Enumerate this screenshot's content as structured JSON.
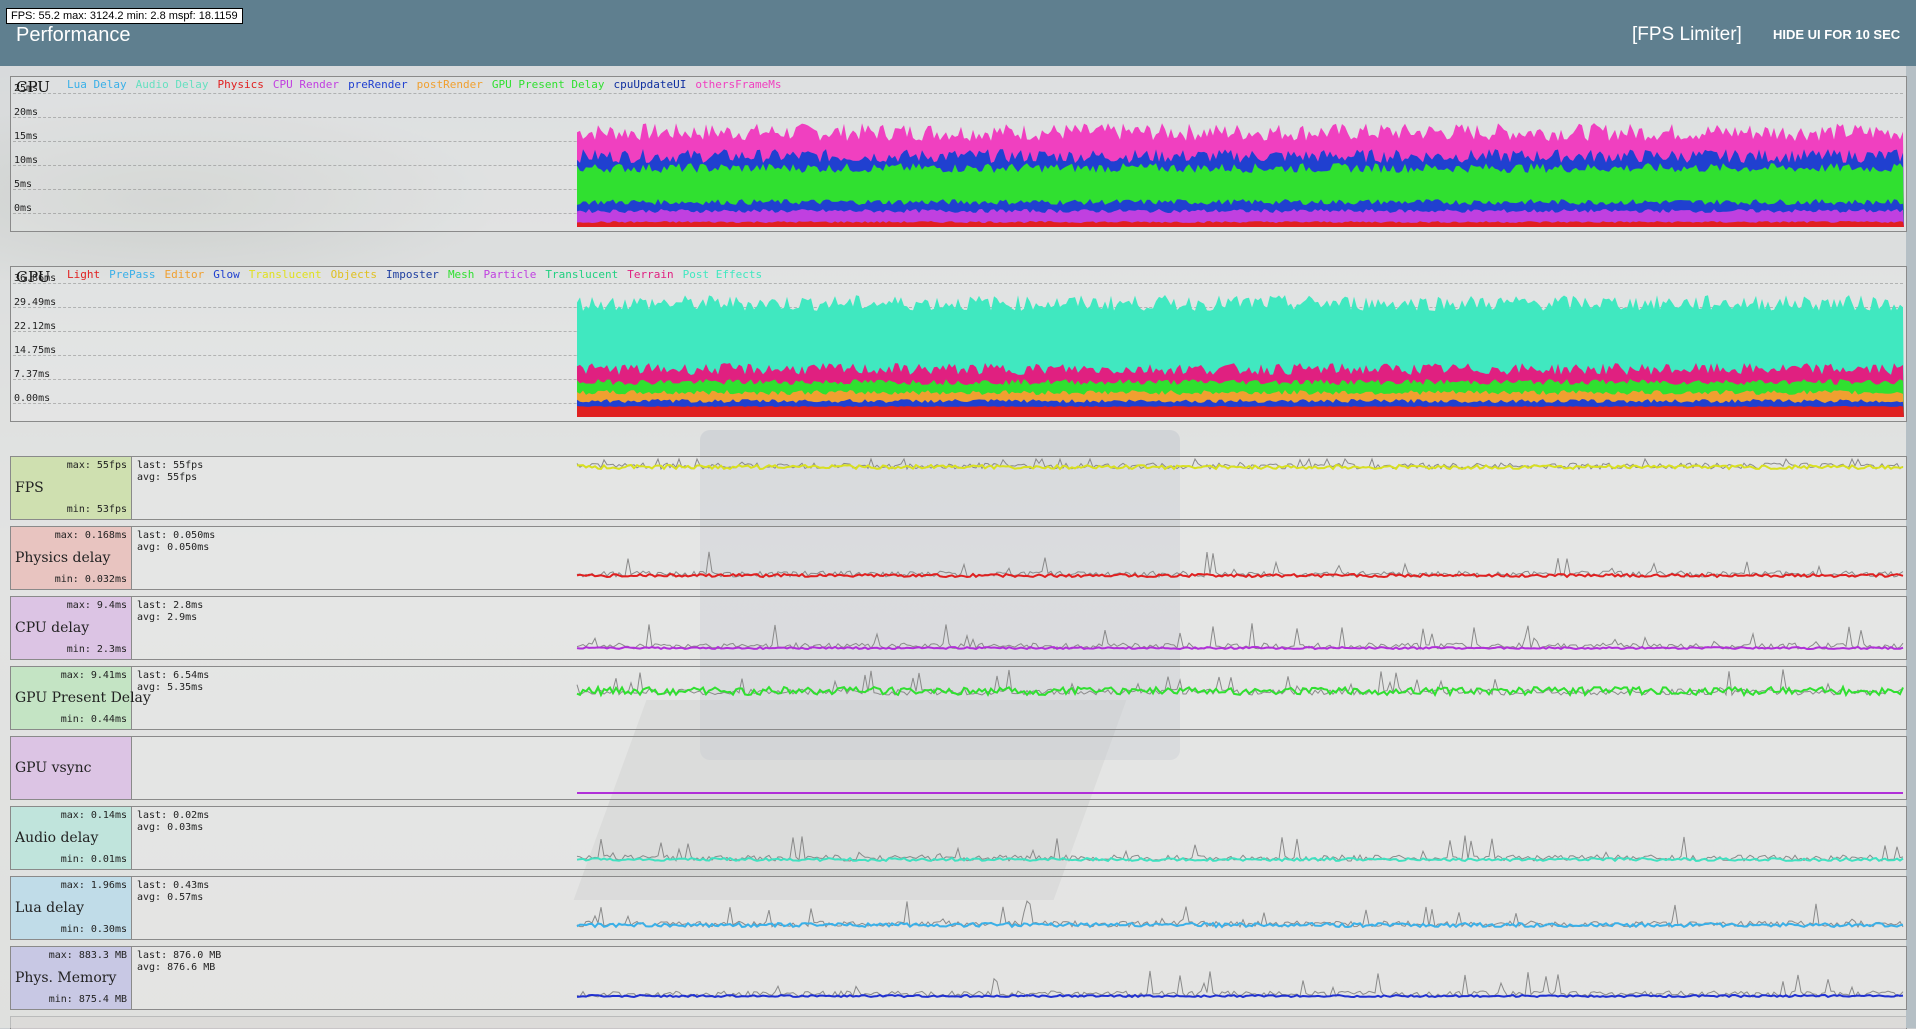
{
  "overlay": {
    "fps_text": "FPS: 55.2  max: 3124.2  min: 2.8  mspf: 18.1159"
  },
  "header": {
    "title": "Performance",
    "fps_limiter": "[FPS Limiter]",
    "hide_ui": "HIDE UI FOR 10 SEC"
  },
  "cpu_graph": {
    "name": "CPU",
    "y_ticks": [
      "25ms",
      "20ms",
      "15ms",
      "10ms",
      "5ms",
      "0ms"
    ],
    "legend": [
      {
        "label": "Lua Delay",
        "color": "#3ab0e8"
      },
      {
        "label": "Audio Delay",
        "color": "#66e0c0"
      },
      {
        "label": "Physics",
        "color": "#e02020"
      },
      {
        "label": "CPU Render",
        "color": "#c040e0"
      },
      {
        "label": "preRender",
        "color": "#2040d0"
      },
      {
        "label": "postRender",
        "color": "#f0a030"
      },
      {
        "label": "GPU Present Delay",
        "color": "#30e030"
      },
      {
        "label": "cpuUpdateUI",
        "color": "#1030a0"
      },
      {
        "label": "othersFrameMs",
        "color": "#f040c0"
      }
    ]
  },
  "gpu_graph": {
    "name": "GPU",
    "y_ticks": [
      "36.86ms",
      "29.49ms",
      "22.12ms",
      "14.75ms",
      "7.37ms",
      "0.00ms"
    ],
    "legend": [
      {
        "label": "Light",
        "color": "#e02020"
      },
      {
        "label": "PrePass",
        "color": "#3ab0e8"
      },
      {
        "label": "Editor",
        "color": "#f0a030"
      },
      {
        "label": "Glow",
        "color": "#2040d0"
      },
      {
        "label": "Translucent",
        "color": "#e0e020"
      },
      {
        "label": "Objects",
        "color": "#e0c020"
      },
      {
        "label": "Imposter",
        "color": "#2040a0"
      },
      {
        "label": "Mesh",
        "color": "#30e030"
      },
      {
        "label": "Particle",
        "color": "#c040e0"
      },
      {
        "label": "Translucent",
        "color": "#20d080"
      },
      {
        "label": "Terrain",
        "color": "#e02080"
      },
      {
        "label": "Post Effects",
        "color": "#40e8c0"
      }
    ]
  },
  "rows": [
    {
      "name": "FPS",
      "max": "max: 55fps",
      "min": "min: 53fps",
      "last": "last: 55fps",
      "avg": "avg: 55fps",
      "color": "#d8e020",
      "bg": "#cfe0b0"
    },
    {
      "name": "Physics delay",
      "max": "max: 0.168ms",
      "min": "min: 0.032ms",
      "last": "last: 0.050ms",
      "avg": "avg: 0.050ms",
      "color": "#e02020",
      "bg": "#e8c4c0"
    },
    {
      "name": "CPU delay",
      "max": "max: 9.4ms",
      "min": "min: 2.3ms",
      "last": "last: 2.8ms",
      "avg": "avg: 2.9ms",
      "color": "#b030d8",
      "bg": "#dcc4e4"
    },
    {
      "name": "GPU Present Delay",
      "max": "max: 9.41ms",
      "min": "min: 0.44ms",
      "last": "last: 6.54ms",
      "avg": "avg: 5.35ms",
      "color": "#30e030",
      "bg": "#c4e4c4"
    },
    {
      "name": "GPU vsync",
      "max": "",
      "min": "",
      "last": "",
      "avg": "",
      "color": "#b030d8",
      "bg": "#dcc4e4"
    },
    {
      "name": "Audio delay",
      "max": "max: 0.14ms",
      "min": "min: 0.01ms",
      "last": "last: 0.02ms",
      "avg": "avg: 0.03ms",
      "color": "#40e0c0",
      "bg": "#c0e4dc"
    },
    {
      "name": "Lua delay",
      "max": "max: 1.96ms",
      "min": "min: 0.30ms",
      "last": "last: 0.43ms",
      "avg": "avg: 0.57ms",
      "color": "#3ab0e8",
      "bg": "#c0dce8"
    },
    {
      "name": "Phys. Memory",
      "max": "max: 883.3 MB",
      "min": "min: 875.4 MB",
      "last": "last: 876.0 MB",
      "avg": "avg: 876.6 MB",
      "color": "#2030d0",
      "bg": "#c8c8e4"
    }
  ]
}
